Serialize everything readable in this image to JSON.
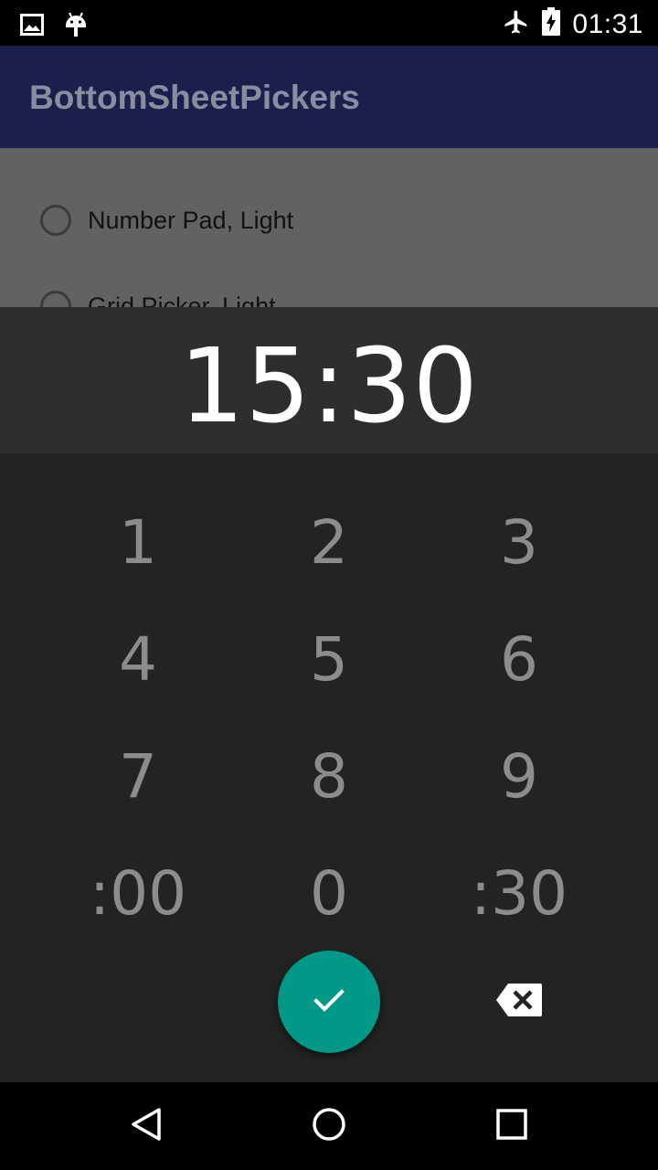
{
  "status_bar": {
    "time": "01:31",
    "left_icons": [
      "image-icon",
      "android-icon"
    ],
    "right_icons": [
      "airplane-icon",
      "battery-charging-icon"
    ]
  },
  "app_bar": {
    "title": "BottomSheetPickers"
  },
  "options": [
    {
      "label": "Number Pad, Light"
    },
    {
      "label": "Grid Picker, Light"
    }
  ],
  "picker": {
    "display_value": "15:30",
    "keys": [
      "1",
      "2",
      "3",
      "4",
      "5",
      "6",
      "7",
      "8",
      "9",
      ":00",
      "0",
      ":30"
    ],
    "confirm_icon": "check-icon",
    "delete_icon": "backspace-icon"
  },
  "colors": {
    "app_bar": "#1a1f4b",
    "fab": "#009988",
    "pad_background": "#232323",
    "header_background": "#2e2e2e"
  },
  "nav_bar": {
    "icons": [
      "back-icon",
      "home-icon",
      "recents-icon"
    ]
  }
}
